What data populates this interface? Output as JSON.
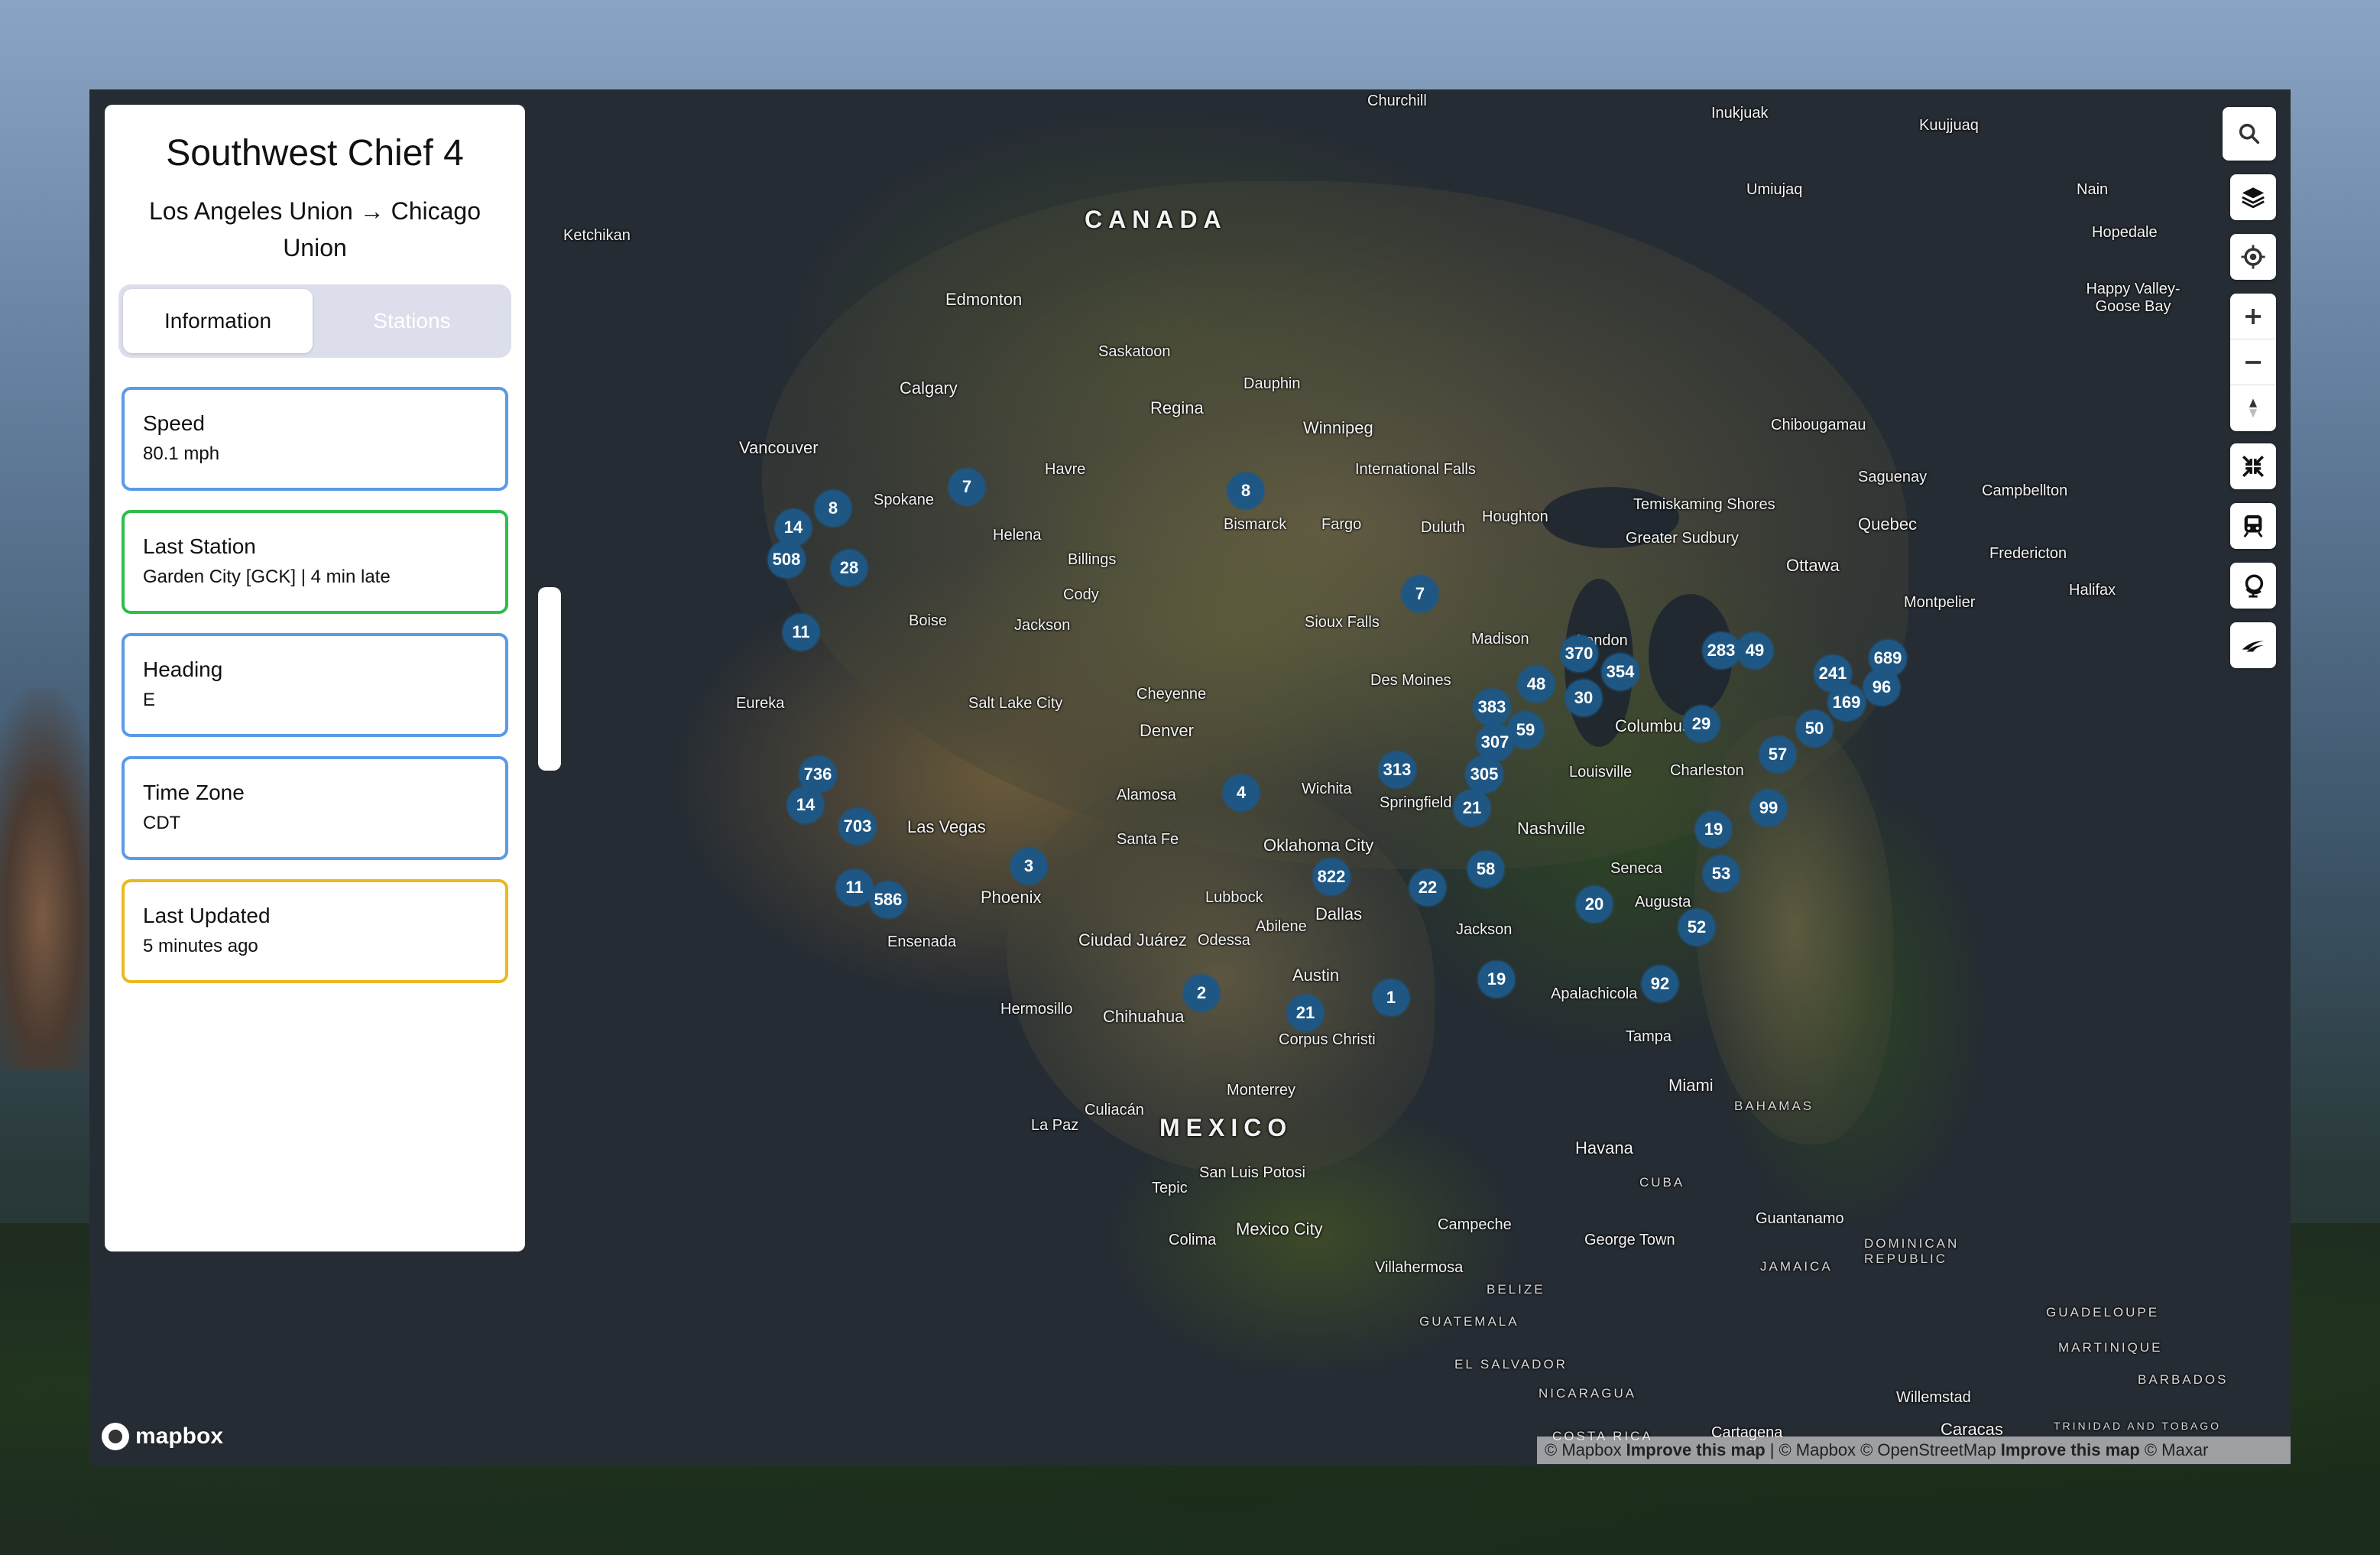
{
  "panel": {
    "title": "Southwest Chief 4",
    "route": "Los Angeles Union → Chicago Union",
    "tabs": [
      {
        "label": "Information",
        "active": true
      },
      {
        "label": "Stations",
        "active": false
      }
    ],
    "cards": [
      {
        "label": "Speed",
        "value": "80.1 mph",
        "color": "#5b9ae6"
      },
      {
        "label": "Last Station",
        "value": "Garden City [GCK] | 4 min late",
        "color": "#2ebd4b"
      },
      {
        "label": "Heading",
        "value": "E",
        "color": "#5b9ae6"
      },
      {
        "label": "Time Zone",
        "value": "CDT",
        "color": "#5b9ae6"
      },
      {
        "label": "Last Updated",
        "value": "5 minutes ago",
        "color": "#ecb81f"
      }
    ]
  },
  "map": {
    "labels": {
      "canada": "CANADA",
      "mexico": "MEXICO",
      "cuba": "CUBA",
      "bahamas": "BAHAMAS",
      "belize": "BELIZE",
      "guatemala": "GUATEMALA",
      "el_salvador": "EL SALVADOR",
      "nicaragua": "NICARAGUA",
      "costa_rica": "COSTA RICA",
      "jamaica": "JAMAICA",
      "dominican_republic": "DOMINICAN REPUBLIC",
      "guadeloupe": "GUADELOUPE",
      "martinique": "MARTINIQUE",
      "barbados": "BARBADOS",
      "trinidad": "TRINIDAD AND TOBAGO",
      "churchill": "Churchill",
      "inukjuak": "Inukjuak",
      "kuujjuaq": "Kuujjuaq",
      "nain": "Nain",
      "hopedale": "Hopedale",
      "happy_valley": "Happy Valley-Goose Bay",
      "umiujaq": "Umiujaq",
      "ketchikan": "Ketchikan",
      "edmonton": "Edmonton",
      "calgary": "Calgary",
      "vancouver": "Vancouver",
      "saskatoon": "Saskatoon",
      "regina": "Regina",
      "winnipeg": "Winnipeg",
      "dauphin": "Dauphin",
      "chibougamau": "Chibougamau",
      "ottawa": "Ottawa",
      "montpelier": "Montpelier",
      "quebec": "Quebec",
      "halifax": "Halifax",
      "fredericton": "Fredericton",
      "campbellton": "Campbellton",
      "saguenay": "Saguenay",
      "houghton": "Houghton",
      "greater_sudbury": "Greater Sudbury",
      "temiskaming": "Temiskaming Shores",
      "international_falls": "International Falls",
      "bismarck": "Bismarck",
      "fargo": "Fargo",
      "duluth": "Duluth",
      "havre": "Havre",
      "spokane": "Spokane",
      "helena": "Helena",
      "billings": "Billings",
      "cody": "Cody",
      "boise": "Boise",
      "jackson": "Jackson",
      "sioux_falls": "Sioux Falls",
      "madison": "Madison",
      "des_moines": "Des Moines",
      "salt_lake_city": "Salt Lake City",
      "cheyenne": "Cheyenne",
      "denver": "Denver",
      "eureka": "Eureka",
      "las_vegas": "Las Vegas",
      "phoenix": "Phoenix",
      "santa_fe": "Santa Fe",
      "alamosa": "Alamosa",
      "wichita": "Wichita",
      "oklahoma_city": "Oklahoma City",
      "springfield": "Springfield",
      "columbus": "Columbus",
      "louisville": "Louisville",
      "charleston": "Charleston",
      "nashville": "Nashville",
      "dallas": "Dallas",
      "lubbock": "Lubbock",
      "abilene": "Abilene",
      "austin": "Austin",
      "corpus_christi": "Corpus Christi",
      "jackson_ms": "Jackson",
      "seneca": "Seneca",
      "augusta": "Augusta",
      "apalachicola": "Apalachicola",
      "tampa": "Tampa",
      "miami": "Miami",
      "havana": "Havana",
      "guantanamo": "Guantanamo",
      "george_town": "George Town",
      "ciudad_juarez": "Ciudad Juárez",
      "odessa": "Odessa",
      "hermosillo": "Hermosillo",
      "chihuahua": "Chihuahua",
      "ensenada": "Ensenada",
      "la_paz": "La Paz",
      "culiacan": "Culiacán",
      "monterrey": "Monterrey",
      "san_luis_potosi": "San Luis Potosi",
      "tepic": "Tepic",
      "colima": "Colima",
      "mexico_city": "Mexico City",
      "campeche": "Campeche",
      "villahermosa": "Villahermosa",
      "willemstad": "Willemstad",
      "cartagena": "Cartagena",
      "caracas": "Caracas",
      "london": "London"
    },
    "clusters": [
      "7",
      "8",
      "14",
      "8",
      "508",
      "28",
      "11",
      "7",
      "8",
      "7",
      "370",
      "48",
      "354",
      "30",
      "283",
      "49",
      "689",
      "241",
      "96",
      "169",
      "383",
      "59",
      "307",
      "29",
      "57",
      "50",
      "313",
      "305",
      "21",
      "4",
      "736",
      "14",
      "703",
      "3",
      "822",
      "22",
      "58",
      "99",
      "19",
      "53",
      "11",
      "586",
      "20",
      "52",
      "2",
      "21",
      "1",
      "19",
      "92"
    ],
    "attribution": {
      "mapbox": "© Mapbox",
      "improve": "Improve this map",
      "separator": "|",
      "mapbox2": "© Mapbox",
      "osm": "© OpenStreetMap",
      "improve2": "Improve this map",
      "maxar": "© Maxar"
    },
    "logo": "mapbox"
  },
  "controls": {
    "search": "search-icon",
    "layers": "layers-icon",
    "locate": "locate-icon",
    "zoom_in": "plus-icon",
    "zoom_out": "minus-icon",
    "compass": "compass-icon",
    "collapse": "collapse-icon",
    "train": "train-icon",
    "globe": "globe-icon",
    "amtrak": "amtrak-icon"
  }
}
